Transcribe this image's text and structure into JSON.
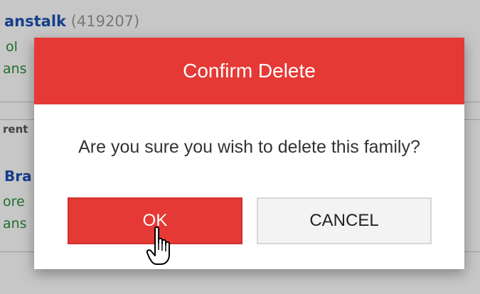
{
  "background": {
    "entry1_name": "anstalk",
    "entry1_id": "(419207)",
    "entry1_line2": "ol",
    "entry1_line3": "ans",
    "section_label": "rent",
    "entry2_name": "Bra",
    "entry2_line2": "ore",
    "entry2_line3": "ans"
  },
  "dialog": {
    "title": "Confirm Delete",
    "message": "Are you sure you wish to delete this family?",
    "ok_label": "OK",
    "cancel_label": "CANCEL"
  },
  "colors": {
    "header": "#e53935",
    "ok_button": "#e53935",
    "cancel_button": "#f3f3f3",
    "link_blue": "#1e50b4",
    "green_text": "#2a8c3a"
  },
  "icons": {
    "cursor": "hand-pointer-icon"
  }
}
